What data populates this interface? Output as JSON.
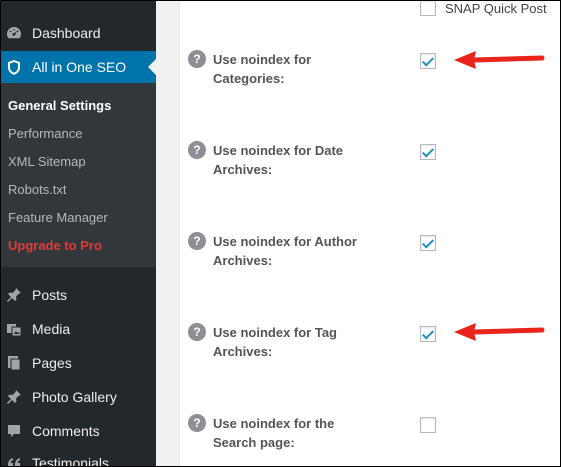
{
  "sidebar": {
    "menu_top": [
      {
        "label": "Dashboard",
        "icon": "dashboard-icon"
      },
      {
        "label": "All in One SEO",
        "icon": "shield-icon"
      }
    ],
    "submenu": [
      {
        "label": "General Settings"
      },
      {
        "label": "Performance"
      },
      {
        "label": "XML Sitemap"
      },
      {
        "label": "Robots.txt"
      },
      {
        "label": "Feature Manager"
      },
      {
        "label": "Upgrade to Pro"
      }
    ],
    "menu_bottom": [
      {
        "label": "Posts",
        "icon": "pin-icon"
      },
      {
        "label": "Media",
        "icon": "media-icon"
      },
      {
        "label": "Pages",
        "icon": "pages-icon"
      },
      {
        "label": "Photo Gallery",
        "icon": "pin-icon"
      },
      {
        "label": "Comments",
        "icon": "comments-icon"
      },
      {
        "label": "Testimonials",
        "icon": "quote-icon"
      }
    ]
  },
  "settings": {
    "snap_label": "SNAP Quick Post",
    "rows": [
      {
        "label": "Use noindex for Categories:",
        "checked": true
      },
      {
        "label": "Use noindex for Date Archives:",
        "checked": true
      },
      {
        "label": "Use noindex for Author Archives:",
        "checked": true
      },
      {
        "label": "Use noindex for Tag Archives:",
        "checked": true
      },
      {
        "label": "Use noindex for the Search page:",
        "checked": false
      }
    ]
  },
  "colors": {
    "sidebar_bg": "#23282d",
    "active_bg": "#0073aa",
    "upgrade_text": "#dd3d36",
    "annotation_arrow": "#e8241b"
  }
}
